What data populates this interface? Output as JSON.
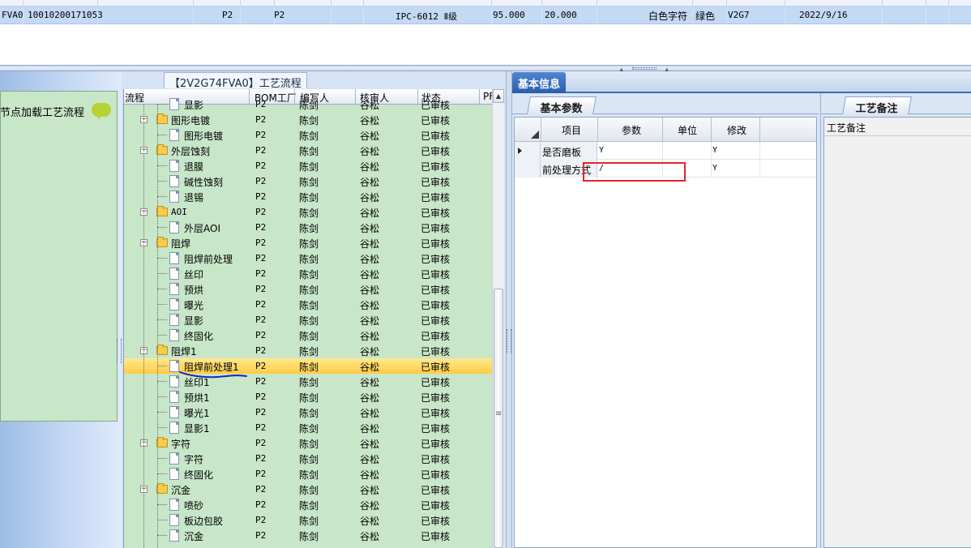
{
  "top_row": {
    "cells": [
      "FVA0",
      "10010200171053",
      "P2",
      "P2",
      "IPC-6012 Ⅱ级",
      "95.000",
      "20.000",
      "白色字符",
      "绿色",
      "V2G7",
      "2022/9/16"
    ]
  },
  "left_panel": {
    "title": "节点加载工艺流程"
  },
  "tree_panel": {
    "caption": "【2V2G74FVA0】工艺流程",
    "columns": [
      "流程",
      "BOM工厂",
      "编写人",
      "核审人",
      "状态",
      "PF"
    ],
    "rows": [
      {
        "name": "显影",
        "level": 2,
        "type": "doc",
        "bom": "P2",
        "writer": "陈剑",
        "reviewer": "谷松",
        "status": "已审核"
      },
      {
        "name": "图形电镀",
        "level": 1,
        "type": "folder",
        "bom": "P2",
        "writer": "陈剑",
        "reviewer": "谷松",
        "status": "已审核"
      },
      {
        "name": "图形电镀",
        "level": 2,
        "type": "doc",
        "bom": "P2",
        "writer": "陈剑",
        "reviewer": "谷松",
        "status": "已审核"
      },
      {
        "name": "外层蚀刻",
        "level": 1,
        "type": "folder",
        "bom": "P2",
        "writer": "陈剑",
        "reviewer": "谷松",
        "status": "已审核"
      },
      {
        "name": "退膜",
        "level": 2,
        "type": "doc",
        "bom": "P2",
        "writer": "陈剑",
        "reviewer": "谷松",
        "status": "已审核"
      },
      {
        "name": "碱性蚀刻",
        "level": 2,
        "type": "doc",
        "bom": "P2",
        "writer": "陈剑",
        "reviewer": "谷松",
        "status": "已审核"
      },
      {
        "name": "退锡",
        "level": 2,
        "type": "doc",
        "bom": "P2",
        "writer": "陈剑",
        "reviewer": "谷松",
        "status": "已审核"
      },
      {
        "name": "AOI",
        "level": 1,
        "type": "folder",
        "bom": "P2",
        "writer": "陈剑",
        "reviewer": "谷松",
        "status": "已审核"
      },
      {
        "name": "外层AOI",
        "level": 2,
        "type": "doc",
        "bom": "P2",
        "writer": "陈剑",
        "reviewer": "谷松",
        "status": "已审核"
      },
      {
        "name": "阻焊",
        "level": 1,
        "type": "folder",
        "bom": "P2",
        "writer": "陈剑",
        "reviewer": "谷松",
        "status": "已审核"
      },
      {
        "name": "阻焊前处理",
        "level": 2,
        "type": "doc",
        "bom": "P2",
        "writer": "陈剑",
        "reviewer": "谷松",
        "status": "已审核"
      },
      {
        "name": "丝印",
        "level": 2,
        "type": "doc",
        "bom": "P2",
        "writer": "陈剑",
        "reviewer": "谷松",
        "status": "已审核"
      },
      {
        "name": "预烘",
        "level": 2,
        "type": "doc",
        "bom": "P2",
        "writer": "陈剑",
        "reviewer": "谷松",
        "status": "已审核"
      },
      {
        "name": "曝光",
        "level": 2,
        "type": "doc",
        "bom": "P2",
        "writer": "陈剑",
        "reviewer": "谷松",
        "status": "已审核"
      },
      {
        "name": "显影",
        "level": 2,
        "type": "doc",
        "bom": "P2",
        "writer": "陈剑",
        "reviewer": "谷松",
        "status": "已审核"
      },
      {
        "name": "终固化",
        "level": 2,
        "type": "doc",
        "bom": "P2",
        "writer": "陈剑",
        "reviewer": "谷松",
        "status": "已审核"
      },
      {
        "name": "阻焊1",
        "level": 1,
        "type": "folder",
        "bom": "P2",
        "writer": "陈剑",
        "reviewer": "谷松",
        "status": "已审核"
      },
      {
        "name": "阻焊前处理1",
        "level": 2,
        "type": "doc",
        "bom": "P2",
        "writer": "陈剑",
        "reviewer": "谷松",
        "status": "已审核",
        "selected": true
      },
      {
        "name": "丝印1",
        "level": 2,
        "type": "doc",
        "bom": "P2",
        "writer": "陈剑",
        "reviewer": "谷松",
        "status": "已审核"
      },
      {
        "name": "预烘1",
        "level": 2,
        "type": "doc",
        "bom": "P2",
        "writer": "陈剑",
        "reviewer": "谷松",
        "status": "已审核"
      },
      {
        "name": "曝光1",
        "level": 2,
        "type": "doc",
        "bom": "P2",
        "writer": "陈剑",
        "reviewer": "谷松",
        "status": "已审核"
      },
      {
        "name": "显影1",
        "level": 2,
        "type": "doc",
        "bom": "P2",
        "writer": "陈剑",
        "reviewer": "谷松",
        "status": "已审核"
      },
      {
        "name": "字符",
        "level": 1,
        "type": "folder",
        "bom": "P2",
        "writer": "陈剑",
        "reviewer": "谷松",
        "status": "已审核"
      },
      {
        "name": "字符",
        "level": 2,
        "type": "doc",
        "bom": "P2",
        "writer": "陈剑",
        "reviewer": "谷松",
        "status": "已审核"
      },
      {
        "name": "终固化",
        "level": 2,
        "type": "doc",
        "bom": "P2",
        "writer": "陈剑",
        "reviewer": "谷松",
        "status": "已审核"
      },
      {
        "name": "沉金",
        "level": 1,
        "type": "folder",
        "bom": "P2",
        "writer": "陈剑",
        "reviewer": "谷松",
        "status": "已审核"
      },
      {
        "name": "喷砂",
        "level": 2,
        "type": "doc",
        "bom": "P2",
        "writer": "陈剑",
        "reviewer": "谷松",
        "status": "已审核"
      },
      {
        "name": "板边包胶",
        "level": 2,
        "type": "doc",
        "bom": "P2",
        "writer": "陈剑",
        "reviewer": "谷松",
        "status": "已审核"
      },
      {
        "name": "沉金",
        "level": 2,
        "type": "doc",
        "bom": "P2",
        "writer": "陈剑",
        "reviewer": "谷松",
        "status": "已审核"
      }
    ]
  },
  "info_panel": {
    "tab_label": "基本信息",
    "params_tab": "基本参数",
    "notes_tab": "工艺备注",
    "notes_label": "工艺备注",
    "columns": [
      "项目",
      "参数",
      "单位",
      "修改"
    ],
    "rows": [
      {
        "item": "是否磨板",
        "param": "Y",
        "unit": "",
        "modify": "Y",
        "current": true
      },
      {
        "item": "前处理方式",
        "param": "/",
        "unit": "",
        "modify": "Y"
      }
    ]
  },
  "colors": {
    "tree_bg": "#c8e6c8",
    "selected_row": "#ffcc44",
    "tab_active": "#2c5ea8",
    "highlight_box": "#e3262b",
    "pen_annotation": "#1a24b8"
  }
}
